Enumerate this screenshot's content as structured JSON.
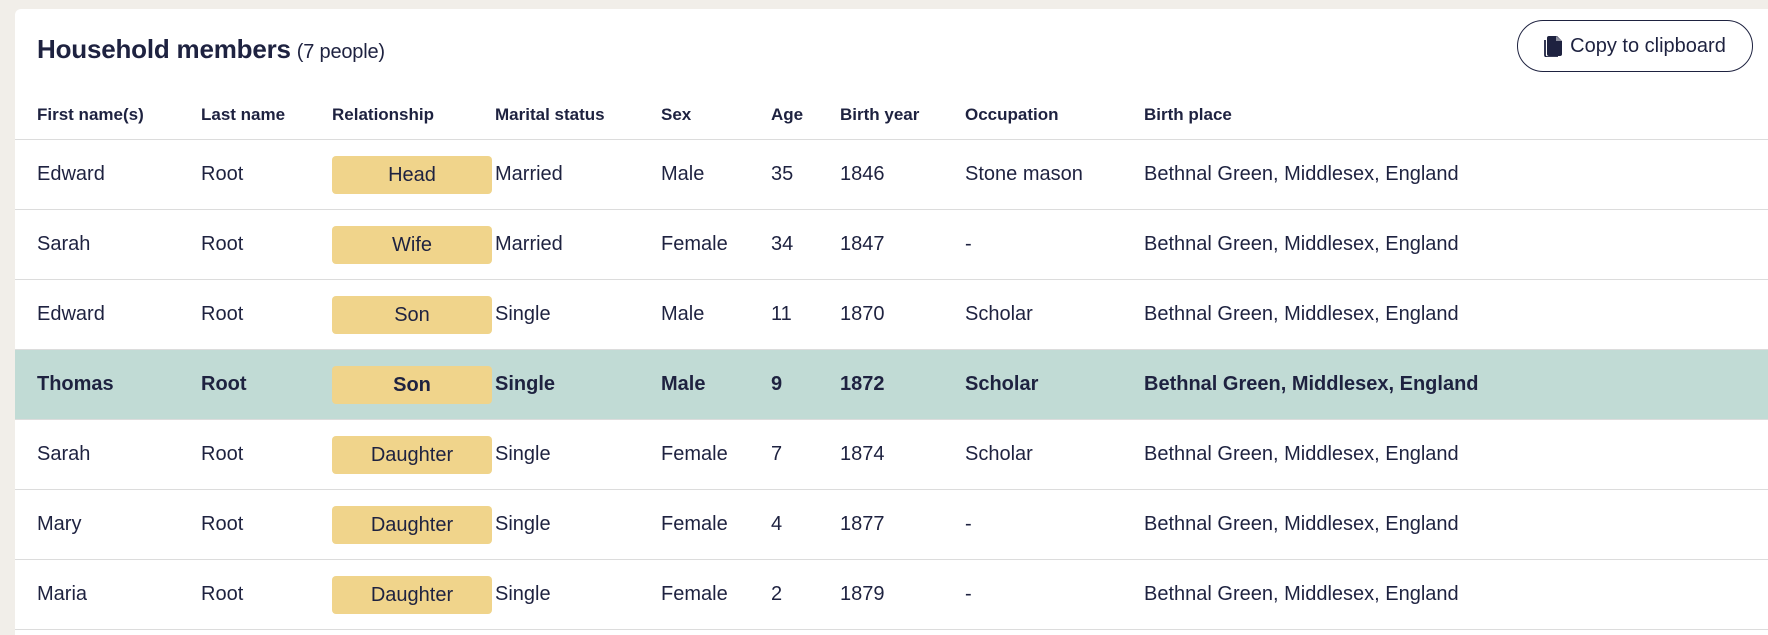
{
  "header": {
    "title": "Household members",
    "count": "(7 people)",
    "copy_button_label": "Copy to clipboard"
  },
  "columns": [
    "First name(s)",
    "Last name",
    "Relationship",
    "Marital status",
    "Sex",
    "Age",
    "Birth year",
    "Occupation",
    "Birth place"
  ],
  "rows": [
    {
      "first": "Edward",
      "last": "Root",
      "relationship": "Head",
      "marital": "Married",
      "sex": "Male",
      "age": "35",
      "birth_year": "1846",
      "occupation": "Stone mason",
      "birth_place": "Bethnal Green, Middlesex, England",
      "selected": false
    },
    {
      "first": "Sarah",
      "last": "Root",
      "relationship": "Wife",
      "marital": "Married",
      "sex": "Female",
      "age": "34",
      "birth_year": "1847",
      "occupation": "-",
      "birth_place": "Bethnal Green, Middlesex, England",
      "selected": false
    },
    {
      "first": "Edward",
      "last": "Root",
      "relationship": "Son",
      "marital": "Single",
      "sex": "Male",
      "age": "11",
      "birth_year": "1870",
      "occupation": "Scholar",
      "birth_place": "Bethnal Green, Middlesex, England",
      "selected": false
    },
    {
      "first": "Thomas",
      "last": "Root",
      "relationship": "Son",
      "marital": "Single",
      "sex": "Male",
      "age": "9",
      "birth_year": "1872",
      "occupation": "Scholar",
      "birth_place": "Bethnal Green, Middlesex, England",
      "selected": true
    },
    {
      "first": "Sarah",
      "last": "Root",
      "relationship": "Daughter",
      "marital": "Single",
      "sex": "Female",
      "age": "7",
      "birth_year": "1874",
      "occupation": "Scholar",
      "birth_place": "Bethnal Green, Middlesex, England",
      "selected": false
    },
    {
      "first": "Mary",
      "last": "Root",
      "relationship": "Daughter",
      "marital": "Single",
      "sex": "Female",
      "age": "4",
      "birth_year": "1877",
      "occupation": "-",
      "birth_place": "Bethnal Green, Middlesex, England",
      "selected": false
    },
    {
      "first": "Maria",
      "last": "Root",
      "relationship": "Daughter",
      "marital": "Single",
      "sex": "Female",
      "age": "2",
      "birth_year": "1879",
      "occupation": "-",
      "birth_place": "Bethnal Green, Middlesex, England",
      "selected": false
    }
  ],
  "colors": {
    "text": "#1e2240",
    "background": "#f1eee9",
    "pill": "#f0d48b",
    "selected_row": "#c1dbd5"
  },
  "icons": {
    "copy": "clipboard-icon"
  }
}
